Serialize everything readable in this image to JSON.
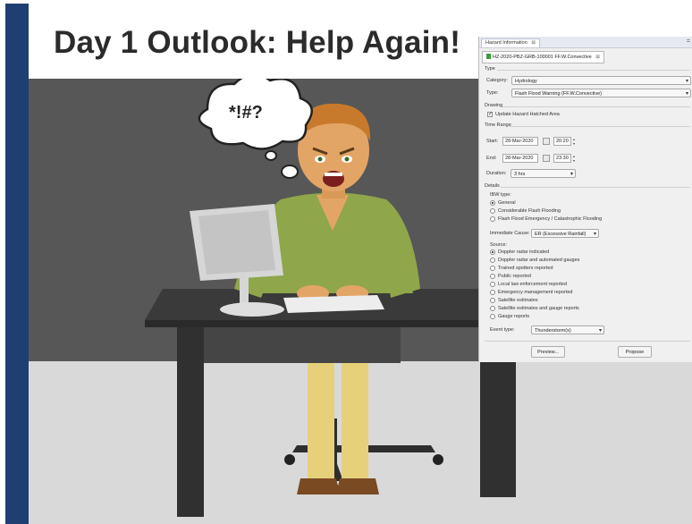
{
  "slide": {
    "title": "Day 1 Outlook: Help Again!",
    "thought_text": "*!#?"
  },
  "panel": {
    "view_tab_label": "Hazard Information",
    "view_tab_close": "⊠",
    "minimize": "=",
    "doc_tab_label": "HZ-2020-PBZ-GRB-100001 FF.W.Convective",
    "doc_tab_close": "⊠",
    "type_section": "Type",
    "category_label": "Category:",
    "category_value": "Hydrology",
    "type_label": "Type:",
    "type_value": "Flash Flood Warning (FF.W.Convective)",
    "drawing_section": "Drawing",
    "update_hazard_label": "Update Hazard Hatched Area",
    "time_section": "Time Range",
    "start_label": "Start:",
    "start_date": "28-Mar-2020",
    "start_time": "20:20",
    "end_label": "End:",
    "end_date": "28-Mar-2020",
    "end_time": "23:30",
    "duration_label": "Duration:",
    "duration_value": "3 hrs",
    "details_section": "Details",
    "ibw_type_label": "IBW type:",
    "ibw_options": [
      "General",
      "Considerable Flash Flooding",
      "Flash Flood Emergency / Catastrophic Flooding"
    ],
    "immediate_cause_label": "Immediate Cause:",
    "immediate_cause_value": "ER (Excessive Rainfall)",
    "source_label": "Source:",
    "source_options": [
      "Doppler radar indicated",
      "Doppler radar and automated gauges",
      "Trained spotters reported",
      "Public reported",
      "Local law enforcement reported",
      "Emergency management reported",
      "Satellite estimates",
      "Satellite estimates and gauge reports",
      "Gauge reports"
    ],
    "event_type_label": "Event type:",
    "event_type_value": "Thunderstorm(s)",
    "preview_button": "Preview...",
    "propose_button": "Propose"
  },
  "colors": {
    "accent_bar": "#1f3f73",
    "wall": "#575757",
    "floor": "#d9d9d9"
  }
}
